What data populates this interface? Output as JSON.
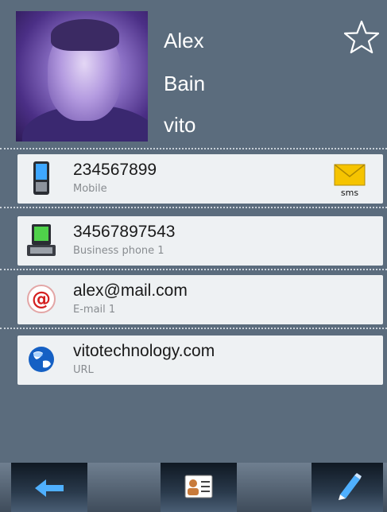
{
  "contact": {
    "first_name": "Alex",
    "last_name": "Bain",
    "company": "vito",
    "favorite_icon": "star-outline-icon"
  },
  "entries": [
    {
      "value": "234567899",
      "label": "Mobile",
      "icon": "mobile-phone-icon",
      "action_icon": "sms-envelope-icon",
      "action_label": "sms"
    },
    {
      "value": "34567897543",
      "label": "Business phone 1",
      "icon": "business-phone-icon"
    },
    {
      "value": "alex@mail.com",
      "label": "E-mail 1",
      "icon": "email-at-icon"
    },
    {
      "value": "vitotechnology.com",
      "label": "URL",
      "icon": "globe-icon"
    }
  ],
  "toolbar": {
    "back_icon": "back-arrow-icon",
    "card_icon": "contact-card-icon",
    "edit_icon": "pencil-edit-icon"
  },
  "colors": {
    "background": "#5b6c7d",
    "row_background": "#eef1f3",
    "accent_blue": "#1d8fe0",
    "sms_yellow": "#f6c400"
  }
}
